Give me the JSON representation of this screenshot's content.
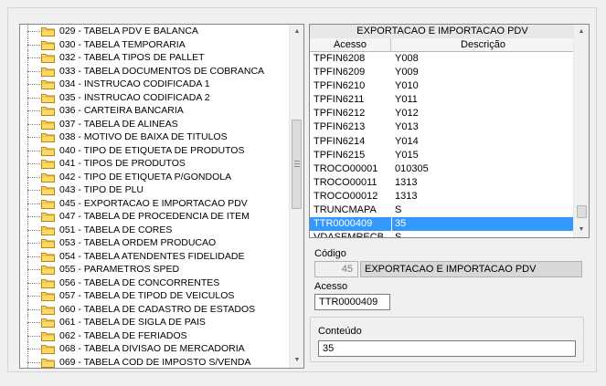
{
  "tree": {
    "items": [
      "029 - TABELA PDV E BALANCA",
      "030 - TABELA TEMPORARIA",
      "032 - TABELA TIPOS DE PALLET",
      "033 - TABELA DOCUMENTOS DE COBRANCA",
      "034 - INSTRUCAO CODIFICADA 1",
      "035 - INSTRUCAO CODIFICADA 2",
      "036 - CARTEIRA BANCARIA",
      "037 - TABELA DE ALINEAS",
      "038 - MOTIVO DE BAIXA DE TITULOS",
      "040 - TIPO DE ETIQUETA DE PRODUTOS",
      "041 - TIPOS DE PRODUTOS",
      "042 - TIPO DE ETIQUETA P/GONDOLA",
      "043 - TIPO DE PLU",
      "045 - EXPORTACAO E IMPORTACAO PDV",
      "047 - TABELA DE PROCEDENCIA DE ITEM",
      "051 - TABELA DE CORES",
      "053 - TABELA ORDEM PRODUCAO",
      "054 - TABELA ATENDENTES FIDELIDADE",
      "055 - PARAMETROS SPED",
      "056 - TABELA DE CONCORRENTES",
      "057 - TABELA DE TIPOD DE VEICULOS",
      "060 - TABELA DE CADASTRO DE ESTADOS",
      "061 - TABELA DE SIGLA DE PAIS",
      "062 - TABELA DE FERIADOS",
      "068 - TABELA  DIVISAO DE MERCADORIA",
      "069 - TABELA COD DE IMPOSTO S/VENDA"
    ]
  },
  "grid": {
    "title": "EXPORTACAO E IMPORTACAO PDV",
    "col_acesso": "Acesso",
    "col_descricao": "Descrição",
    "rows": [
      {
        "acesso": "TPFIN6208",
        "descricao": "Y008"
      },
      {
        "acesso": "TPFIN6209",
        "descricao": "Y009"
      },
      {
        "acesso": "TPFIN6210",
        "descricao": "Y010"
      },
      {
        "acesso": "TPFIN6211",
        "descricao": "Y011"
      },
      {
        "acesso": "TPFIN6212",
        "descricao": "Y012"
      },
      {
        "acesso": "TPFIN6213",
        "descricao": "Y013"
      },
      {
        "acesso": "TPFIN6214",
        "descricao": "Y014"
      },
      {
        "acesso": "TPFIN6215",
        "descricao": "Y015"
      },
      {
        "acesso": "TROCO00001",
        "descricao": "010305"
      },
      {
        "acesso": "TROCO00011",
        "descricao": "1313"
      },
      {
        "acesso": "TROCO00012",
        "descricao": "1313"
      },
      {
        "acesso": "TRUNCMAPA",
        "descricao": "S"
      },
      {
        "acesso": "TTR0000409",
        "descricao": "35"
      },
      {
        "acesso": "VDASEMRECB",
        "descricao": "S"
      }
    ],
    "selected_index": 12
  },
  "detail": {
    "codigo_label": "Código",
    "codigo_value": "45",
    "codigo_desc": "EXPORTACAO E IMPORTACAO PDV",
    "acesso_label": "Acesso",
    "acesso_value": "TTR0000409",
    "conteudo_label": "Conteúdo",
    "conteudo_value": "35"
  },
  "colors": {
    "selection": "#3399ff",
    "folder": "#ffd966"
  }
}
